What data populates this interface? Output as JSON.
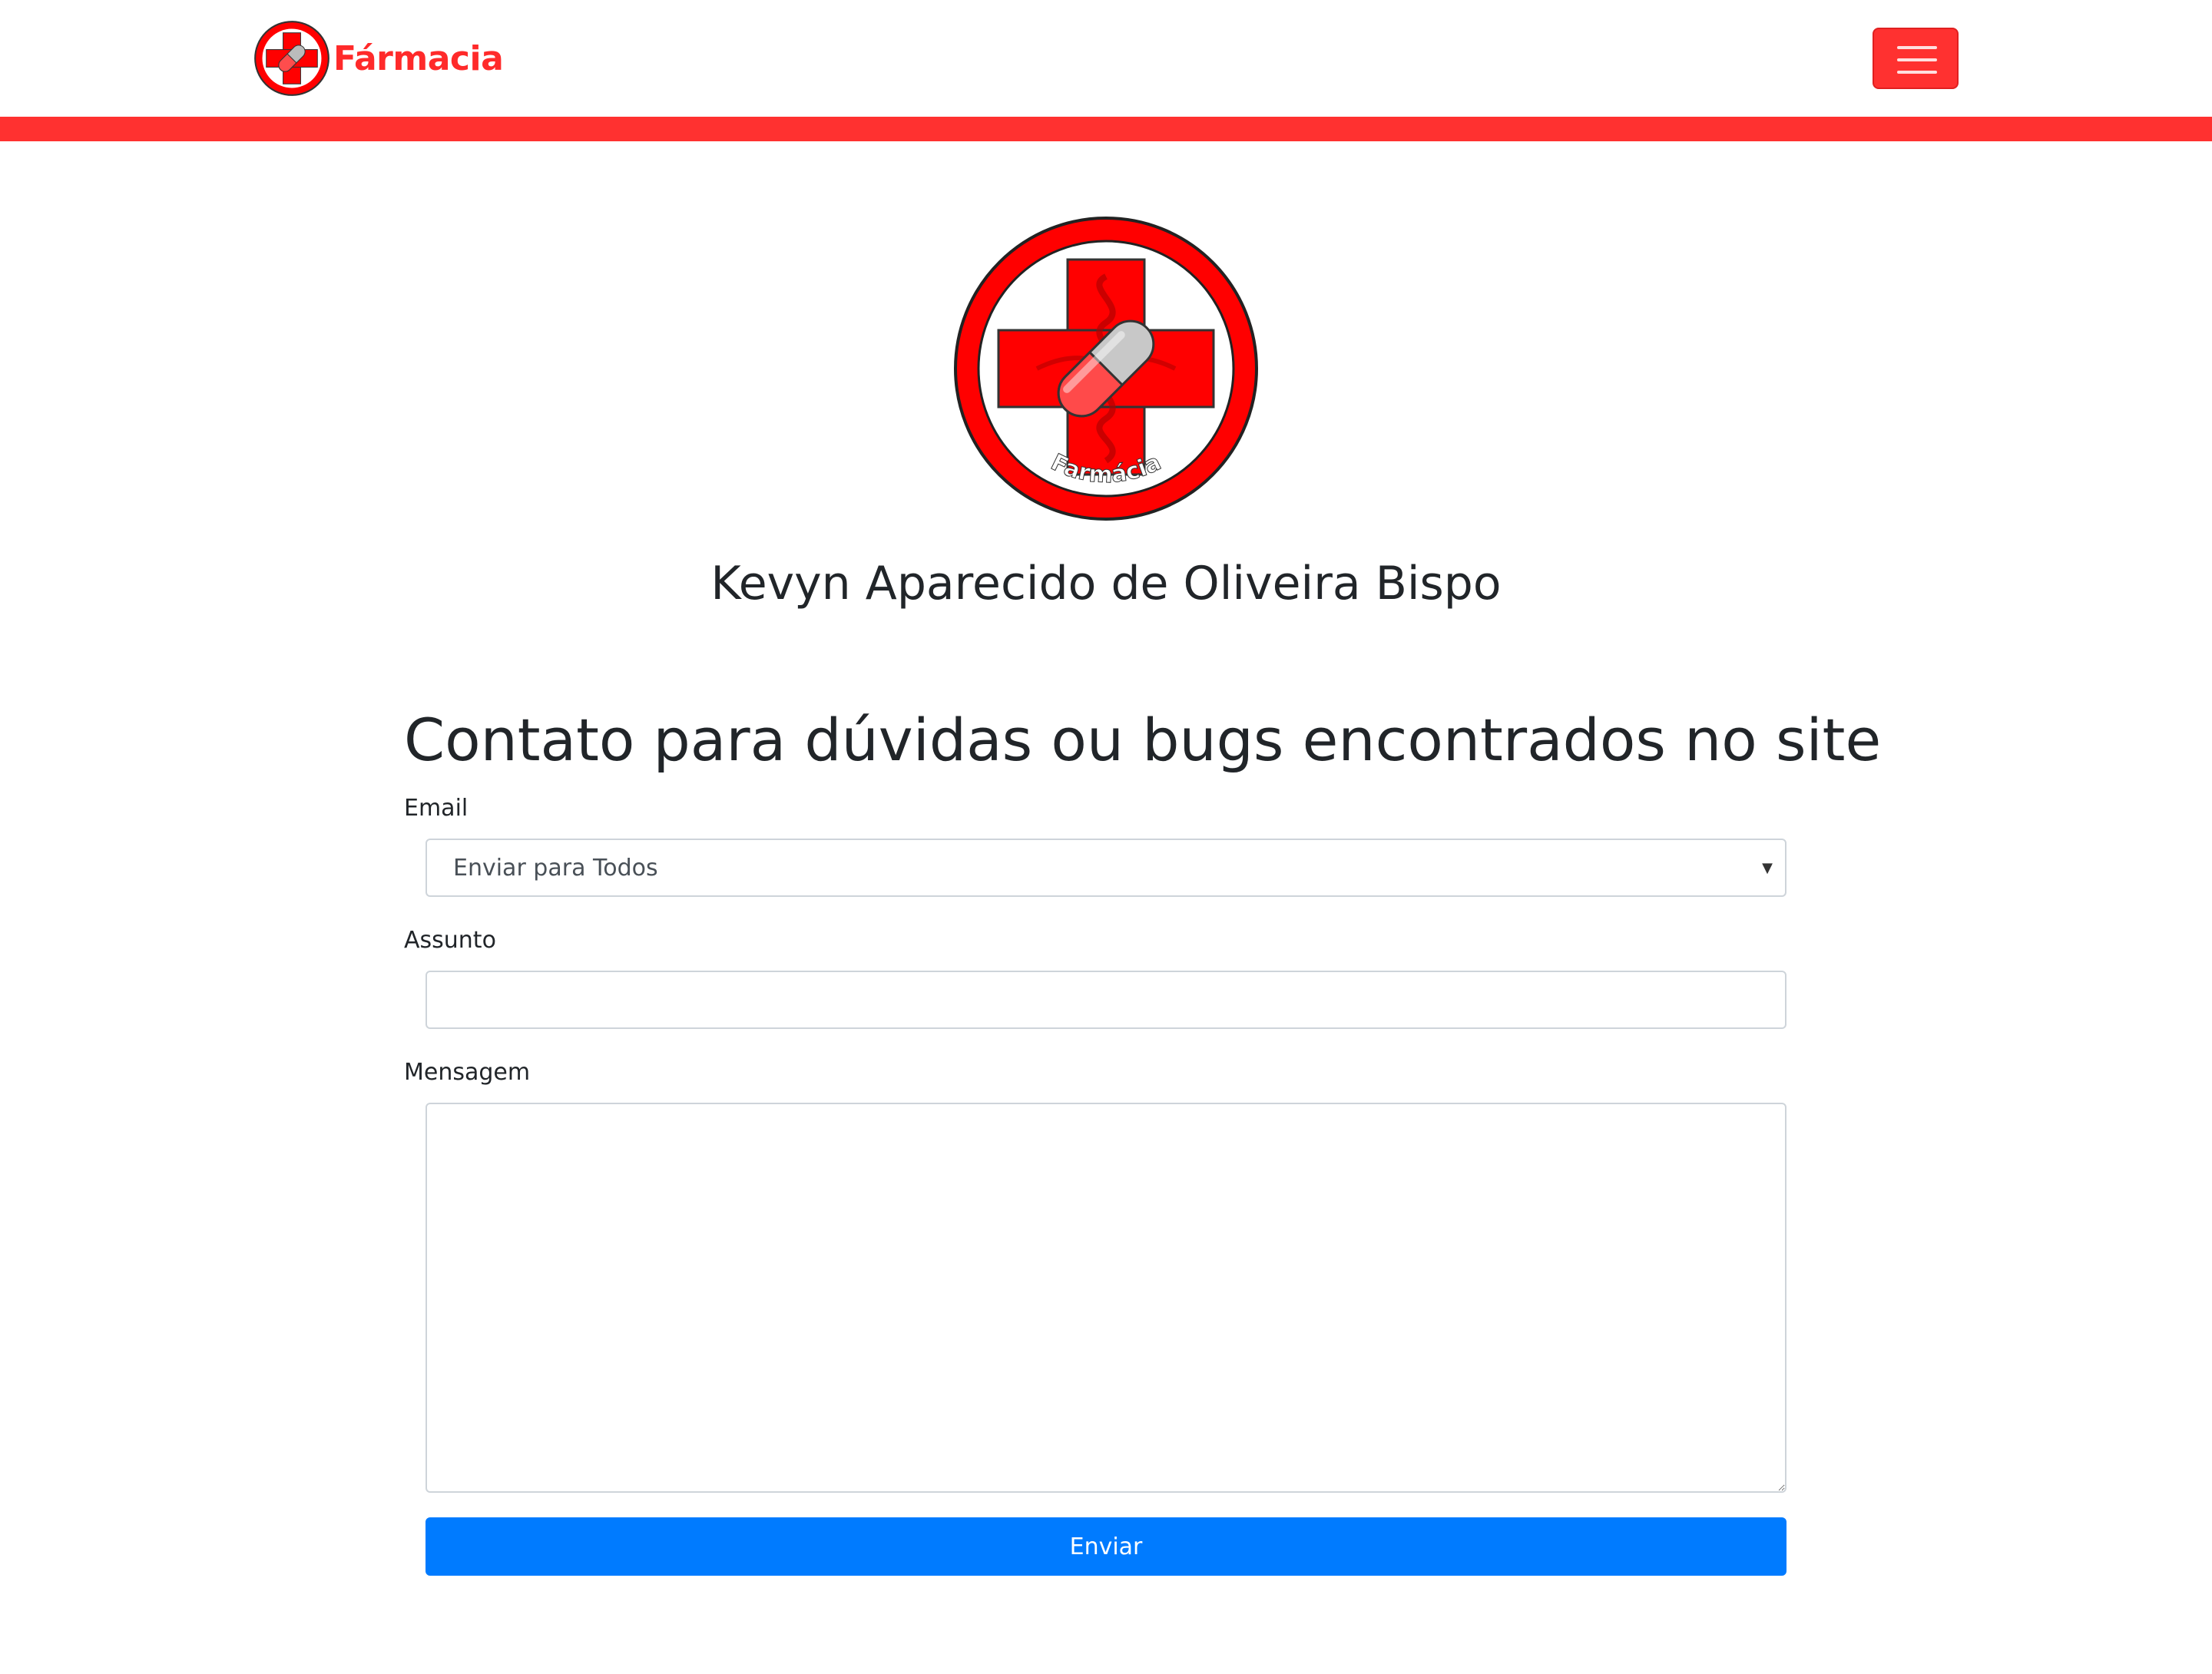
{
  "navbar": {
    "brand_text": "Fármacia",
    "menu_toggle_icon": "hamburger-icon"
  },
  "hero": {
    "logo_icon": "pharmacy-cross-capsule-logo",
    "logo_caption": "Farmácia",
    "owner_name": "Kevyn Aparecido de Oliveira Bispo"
  },
  "contact_form": {
    "title": "Contato para dúvidas ou bugs encontrados no site",
    "email_label": "Email",
    "email_selected": "Enviar para Todos",
    "subject_label": "Assunto",
    "subject_value": "",
    "message_label": "Mensagem",
    "message_value": "",
    "submit_label": "Enviar"
  },
  "colors": {
    "brand_red": "#ff3130",
    "primary_blue": "#007bff"
  }
}
